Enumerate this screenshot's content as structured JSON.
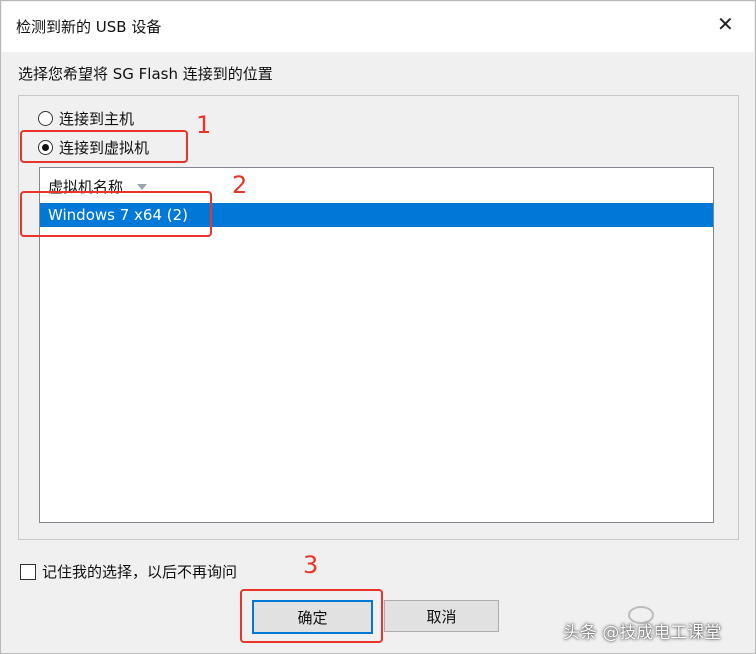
{
  "dialog": {
    "title": "检测到新的 USB 设备",
    "close_icon": "close-icon",
    "prompt": "选择您希望将 SG Flash 连接到的位置"
  },
  "options": {
    "host_label": "连接到主机",
    "vm_label": "连接到虚拟机",
    "selected": "vm"
  },
  "vm_list": {
    "column_header": "虚拟机名称",
    "items": [
      {
        "label": "Windows 7 x64 (2)",
        "selected": true
      }
    ]
  },
  "remember": {
    "label": "记住我的选择，以后不再询问",
    "checked": false
  },
  "buttons": {
    "ok": "确定",
    "cancel": "取消"
  },
  "annotations": {
    "step1": "1",
    "step2": "2",
    "step3": "3",
    "color": "#e8352c"
  },
  "watermark": {
    "text": "头条 @技成电工课堂"
  },
  "colors": {
    "selection": "#0078d7",
    "window_bg": "#f0f0f0"
  }
}
